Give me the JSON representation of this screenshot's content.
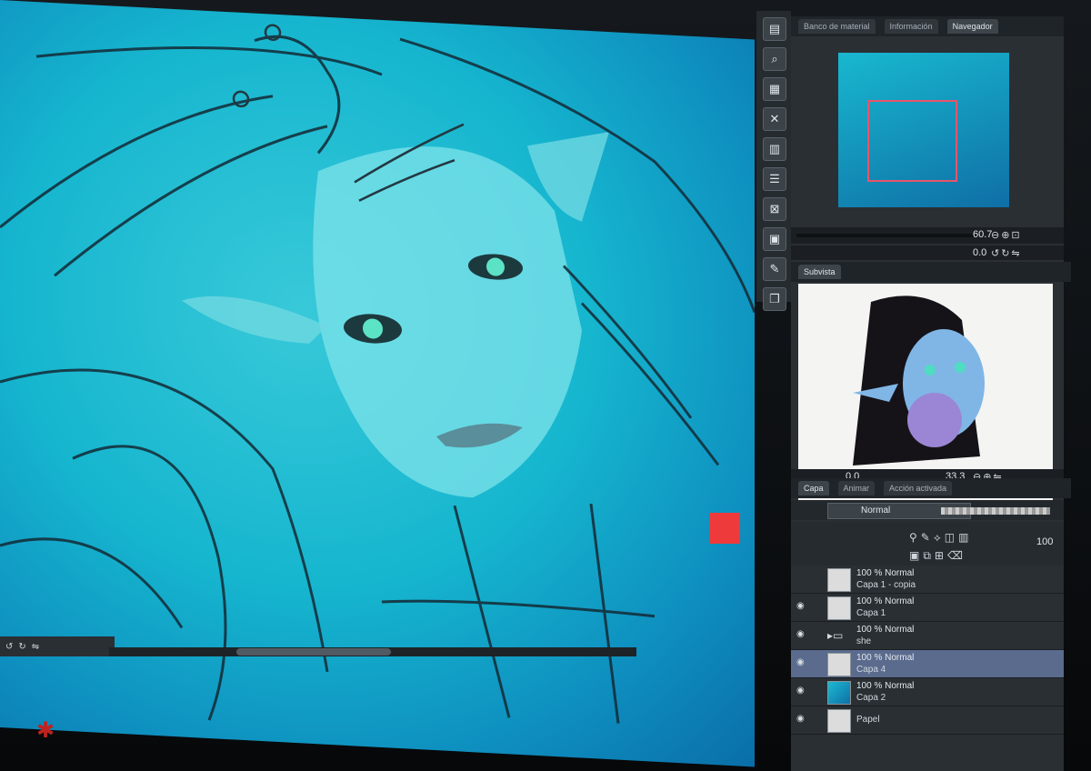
{
  "navigator": {
    "tabs": [
      "Banco de material",
      "Información",
      "Navegador"
    ],
    "zoom": "60.7",
    "rotation": "0.0"
  },
  "subview": {
    "tab": "Subvista",
    "zoom": "33.3",
    "rotation": "0.0"
  },
  "layers": {
    "tabs": [
      "Capa",
      "Animar",
      "Acción activada"
    ],
    "blend_mode": "Normal",
    "opacity": "100",
    "items": [
      {
        "mode": "100 % Normal",
        "name": "Capa 1 - copia",
        "thumb": "plain",
        "selected": false
      },
      {
        "mode": "100 % Normal",
        "name": "Capa 1",
        "thumb": "plain",
        "selected": false
      },
      {
        "mode": "100 % Normal",
        "name": "she",
        "thumb": "folder",
        "selected": false
      },
      {
        "mode": "100 % Normal",
        "name": "Capa 4",
        "thumb": "plain",
        "selected": true
      },
      {
        "mode": "100 % Normal",
        "name": "Capa 2",
        "thumb": "blue",
        "selected": false
      },
      {
        "mode": "",
        "name": "Papel",
        "thumb": "plain",
        "selected": false
      }
    ]
  },
  "colors": {
    "canvas_blue": "#16b6cf",
    "panel_bg": "#2a2f34",
    "selected_layer": "#5a6b8e",
    "nav_rect": "#e8556b",
    "red_chip": "#ee3a3a"
  },
  "icons": [
    "eye-icon",
    "folder-icon",
    "navigator-icon",
    "zoom-icon",
    "close-icon"
  ]
}
